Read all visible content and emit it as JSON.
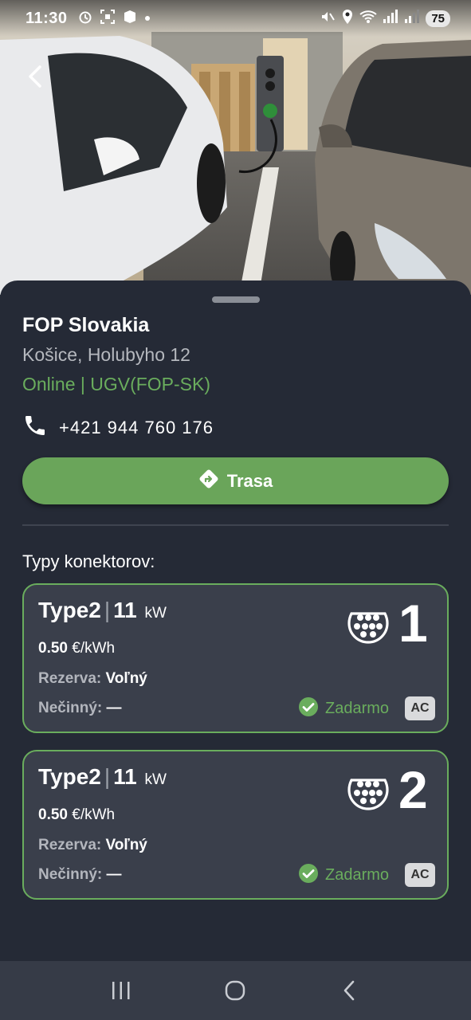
{
  "status_bar": {
    "time": "11:30",
    "battery": "75"
  },
  "station": {
    "name": "FOP Slovakia",
    "address": "Košice, Holubyho 12",
    "status": "Online | UGV(FOP-SK)",
    "phone": "+421 944 760 176"
  },
  "actions": {
    "route_label": "Trasa"
  },
  "connectors_section": {
    "label": "Typy konektorov:"
  },
  "connectors": [
    {
      "type": "Type2",
      "separator": "|",
      "power": "11",
      "power_unit": "kW",
      "price": "0.50",
      "price_unit": "€/kWh",
      "reservation_label": "Rezerva:",
      "reservation_value": "Voľný",
      "idle_label": "Nečinný:",
      "idle_value": "—",
      "free_label": "Zadarmo",
      "current_type": "AC",
      "number": "1"
    },
    {
      "type": "Type2",
      "separator": "|",
      "power": "11",
      "power_unit": "kW",
      "price": "0.50",
      "price_unit": "€/kWh",
      "reservation_label": "Rezerva:",
      "reservation_value": "Voľný",
      "idle_label": "Nečinný:",
      "idle_value": "—",
      "free_label": "Zadarmo",
      "current_type": "AC",
      "number": "2"
    }
  ],
  "colors": {
    "background": "#252a36",
    "card": "#3a3f4b",
    "accent_green": "#6aad5d",
    "button_green": "#6aa55a"
  },
  "icons": {
    "back": "back-arrow-icon",
    "phone": "phone-icon",
    "route": "directions-icon",
    "connector": "type2-connector-icon",
    "free": "check-circle-icon",
    "nav_recent": "recent-apps-icon",
    "nav_home": "home-icon",
    "nav_back": "nav-back-icon"
  }
}
